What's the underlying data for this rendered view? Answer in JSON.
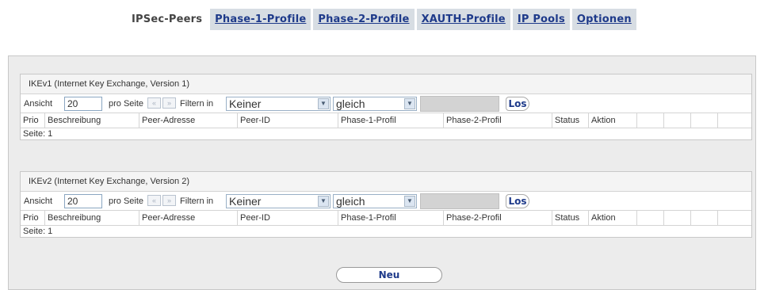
{
  "tabs": [
    {
      "label": "IPSec-Peers",
      "active": true
    },
    {
      "label": "Phase-1-Profile",
      "active": false
    },
    {
      "label": "Phase-2-Profile",
      "active": false
    },
    {
      "label": "XAUTH-Profile",
      "active": false
    },
    {
      "label": "IP Pools",
      "active": false
    },
    {
      "label": "Optionen",
      "active": false
    }
  ],
  "filter_labels": {
    "view": "Ansicht",
    "per_page": "pro Seite",
    "filter_in": "Filtern in",
    "prev": "«",
    "next": "»",
    "go": "Los"
  },
  "columns": [
    "Prio",
    "Beschreibung",
    "Peer-Adresse",
    "Peer-ID",
    "Phase-1-Profil",
    "Phase-2-Profil",
    "Status",
    "Aktion"
  ],
  "ikev1": {
    "title": "IKEv1 (Internet Key Exchange, Version 1)",
    "per_page_value": "20",
    "filter_field": "Keiner",
    "filter_op": "gleich",
    "filter_value": "",
    "page": "Seite: 1"
  },
  "ikev2": {
    "title": "IKEv2 (Internet Key Exchange, Version 2)",
    "per_page_value": "20",
    "filter_field": "Keiner",
    "filter_op": "gleich",
    "filter_value": "",
    "page": "Seite: 1"
  },
  "new_button": "Neu",
  "colors": {
    "tab_bg": "#d7dde3",
    "link_blue": "#1e3a8a",
    "panel_bg": "#ececec"
  }
}
